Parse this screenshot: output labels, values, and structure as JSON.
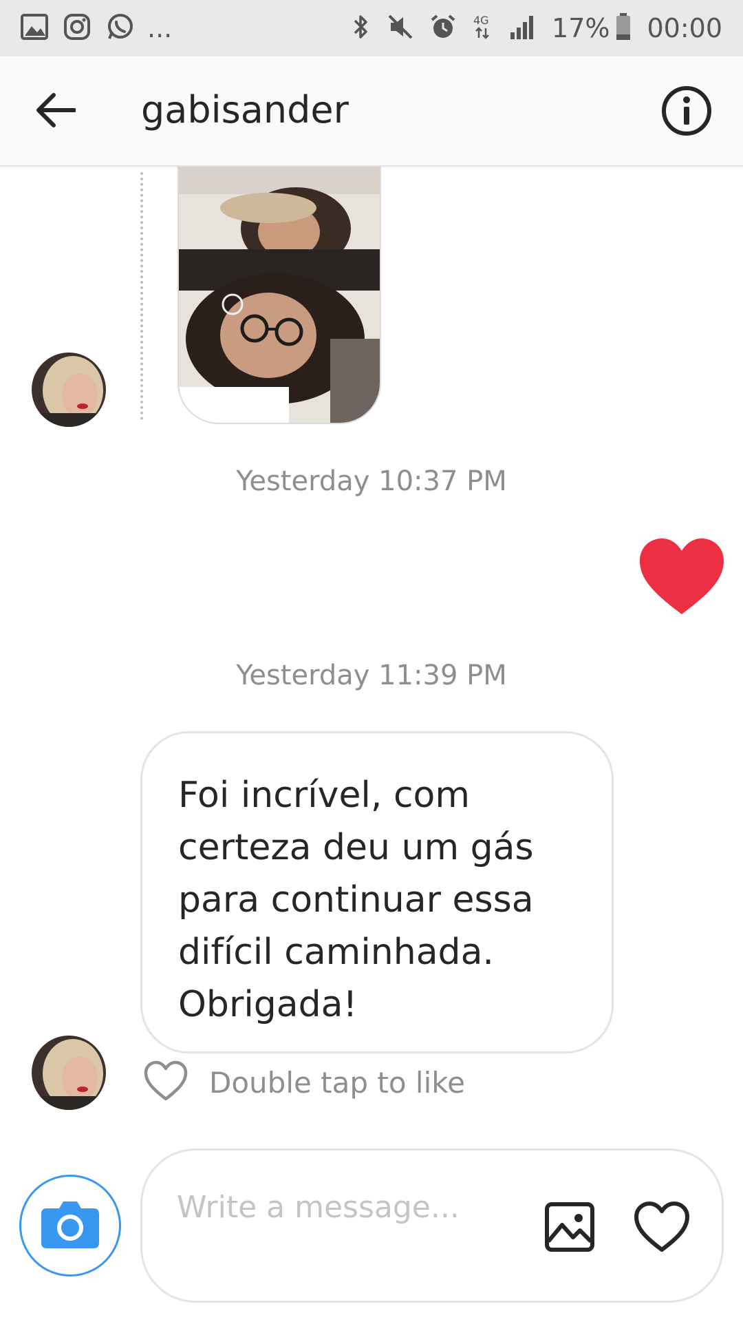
{
  "status_bar": {
    "left_icons": [
      "image-icon",
      "instagram-icon",
      "whatsapp-icon"
    ],
    "overflow": "...",
    "right_icons": [
      "bluetooth-icon",
      "mute-icon",
      "alarm-icon",
      "network-4g-icon",
      "signal-icon"
    ],
    "battery_percent": "17%",
    "time": "00:00"
  },
  "header": {
    "title": "gabisander",
    "back_icon": "back-arrow-icon",
    "info_icon": "info-icon"
  },
  "thread": {
    "timestamp_1": "Yesterday 10:37 PM",
    "sent_heart_color": "#ed2f44",
    "timestamp_2": "Yesterday 11:39 PM",
    "message_lines": [
      "Foi incrível, com",
      "certeza deu um gás",
      "para continuar essa",
      "difícil caminhada.",
      "Obrigada!"
    ],
    "like_hint": "Double tap to like"
  },
  "composer": {
    "placeholder": "Write a message...",
    "camera_color": "#3897f0"
  }
}
